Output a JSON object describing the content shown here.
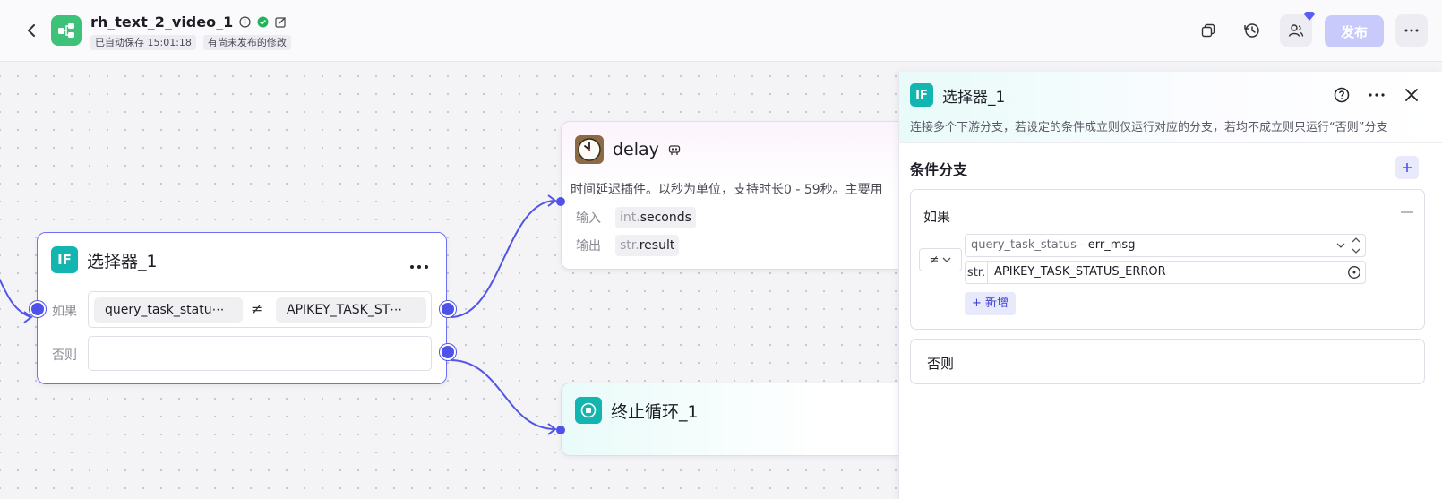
{
  "header": {
    "workflow_title": "rh_text_2_video_1",
    "autosave_text": "已自动保存 15:01:18",
    "unpublished_text": "有尚未发布的修改",
    "publish_label": "发布"
  },
  "canvas": {
    "if_node": {
      "icon_text": "IF",
      "title": "选择器_1",
      "if_label": "如果",
      "else_label": "否则",
      "left_operand": "query_task_statu⋯",
      "operator_symbol": "≠",
      "right_operand": "APIKEY_TASK_ST⋯"
    },
    "delay_node": {
      "title": "delay",
      "description": "时间延迟插件。以秒为单位，支持时长0 - 59秒。主要用",
      "input_label": "输入",
      "input_type": "int.",
      "input_name": "seconds",
      "output_label": "输出",
      "output_type": "str.",
      "output_name": "result"
    },
    "end_loop_node": {
      "title": "终止循环_1"
    }
  },
  "panel": {
    "icon_text": "IF",
    "title": "选择器_1",
    "description": "连接多个下游分支，若设定的条件成立则仅运行对应的分支，若均不成立则只运行“否则”分支",
    "section_title": "条件分支",
    "if_branch": {
      "label": "如果",
      "operator_symbol": "≠",
      "variable_muted": "query_task_status - ",
      "variable_field": "err_msg",
      "value_type": "str.",
      "value": "APIKEY_TASK_STATUS_ERROR",
      "add_label": "+ 新增"
    },
    "else_branch": {
      "label": "否则"
    }
  },
  "colors": {
    "accent": "#4e52e8",
    "node_icon_teal": "#12b5b0",
    "app_logo_green": "#3ec27a",
    "publish_disabled": "#c8cafb"
  },
  "icons": [
    "back-arrow-icon",
    "app-logo-icon",
    "info-icon",
    "check-circle-icon",
    "edit-icon",
    "copy-icon",
    "history-icon",
    "collaborators-icon",
    "more-icon",
    "clock-icon",
    "plugin-icon",
    "stop-icon",
    "help-icon",
    "close-icon"
  ]
}
